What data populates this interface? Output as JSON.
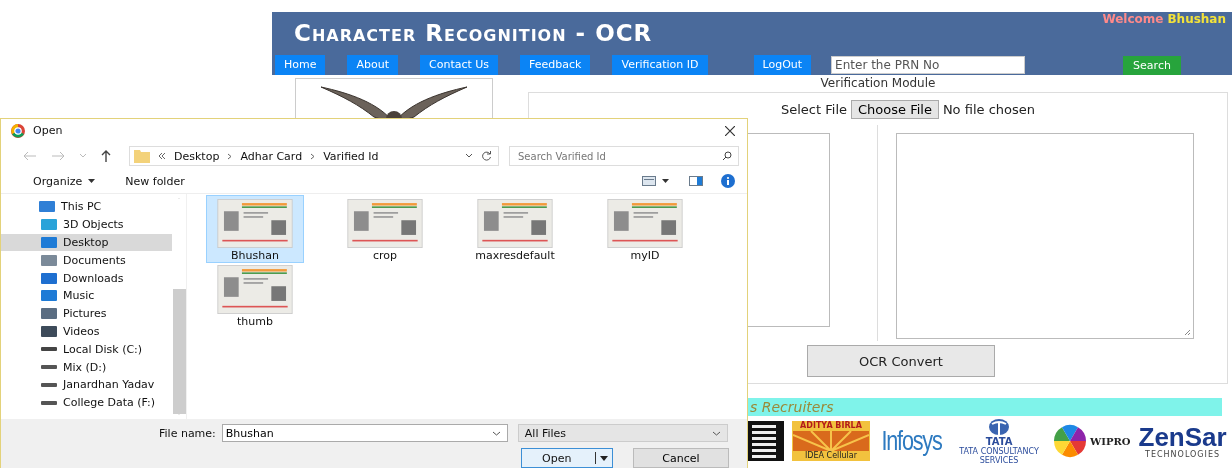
{
  "header": {
    "title": "Character Recognition - OCR",
    "welcome": "Welcome",
    "user": "Bhushan"
  },
  "nav": {
    "links": [
      "Home",
      "About",
      "Contact Us",
      "Feedback",
      "Verification ID",
      "LogOut"
    ],
    "prn_field": {
      "placeholder": "Enter the PRN No"
    },
    "search_button": "Search"
  },
  "verification": {
    "heading": "Verification Module",
    "file_label": "Select File",
    "choose_button": "Choose File",
    "file_status": "No file chosen",
    "convert_button": "OCR Convert"
  },
  "recruiters": {
    "heading": "s Recruiters",
    "logos": [
      {
        "kind": "stripes"
      },
      {
        "kind": "sunburst",
        "name": "ADITYA BIRLA",
        "tagline": "IDEA Cellular"
      },
      {
        "kind": "wordmark",
        "name": "Infosys"
      },
      {
        "kind": "emblem",
        "name": "TATA",
        "tagline": "TATA CONSULTANCY SERVICES"
      },
      {
        "kind": "swirl",
        "name": "WIPRO"
      },
      {
        "kind": "boldmark",
        "name": "ZenSar",
        "tagline": "TECHNOLOGIES"
      }
    ]
  },
  "dialog": {
    "title": "Open",
    "path": [
      "Desktop",
      "Adhar Card",
      "Varified Id"
    ],
    "search": {
      "placeholder": "Search Varified Id"
    },
    "toolbar": [
      "Organize",
      "New folder"
    ],
    "nav_items": [
      {
        "label": "This PC",
        "kind": "pc",
        "selected": false,
        "children": [
          {
            "label": "3D Objects",
            "kind": "cube",
            "selected": false
          },
          {
            "label": "Desktop",
            "kind": "desktop",
            "selected": true
          },
          {
            "label": "Documents",
            "kind": "documents",
            "selected": false
          },
          {
            "label": "Downloads",
            "kind": "downloads",
            "selected": false
          },
          {
            "label": "Music",
            "kind": "music",
            "selected": false
          },
          {
            "label": "Pictures",
            "kind": "pictures",
            "selected": false
          },
          {
            "label": "Videos",
            "kind": "videos",
            "selected": false
          },
          {
            "label": "Local Disk (C:)",
            "kind": "system-disk",
            "selected": false
          },
          {
            "label": "Mix (D:)",
            "kind": "drive",
            "selected": false
          },
          {
            "label": "Janardhan Yadav",
            "kind": "drive",
            "selected": false
          },
          {
            "label": "College Data (F:)",
            "kind": "drive",
            "selected": false
          }
        ]
      }
    ],
    "files": [
      {
        "name": "Bhushan",
        "selected": true
      },
      {
        "name": "crop",
        "selected": false
      },
      {
        "name": "maxresdefault",
        "selected": false
      },
      {
        "name": "myID",
        "selected": false
      },
      {
        "name": "thumb",
        "selected": false
      }
    ],
    "file_name_label": "File name:",
    "file_name": "Bhushan",
    "filter": "All Files",
    "buttons": [
      "Open",
      "Cancel"
    ]
  }
}
